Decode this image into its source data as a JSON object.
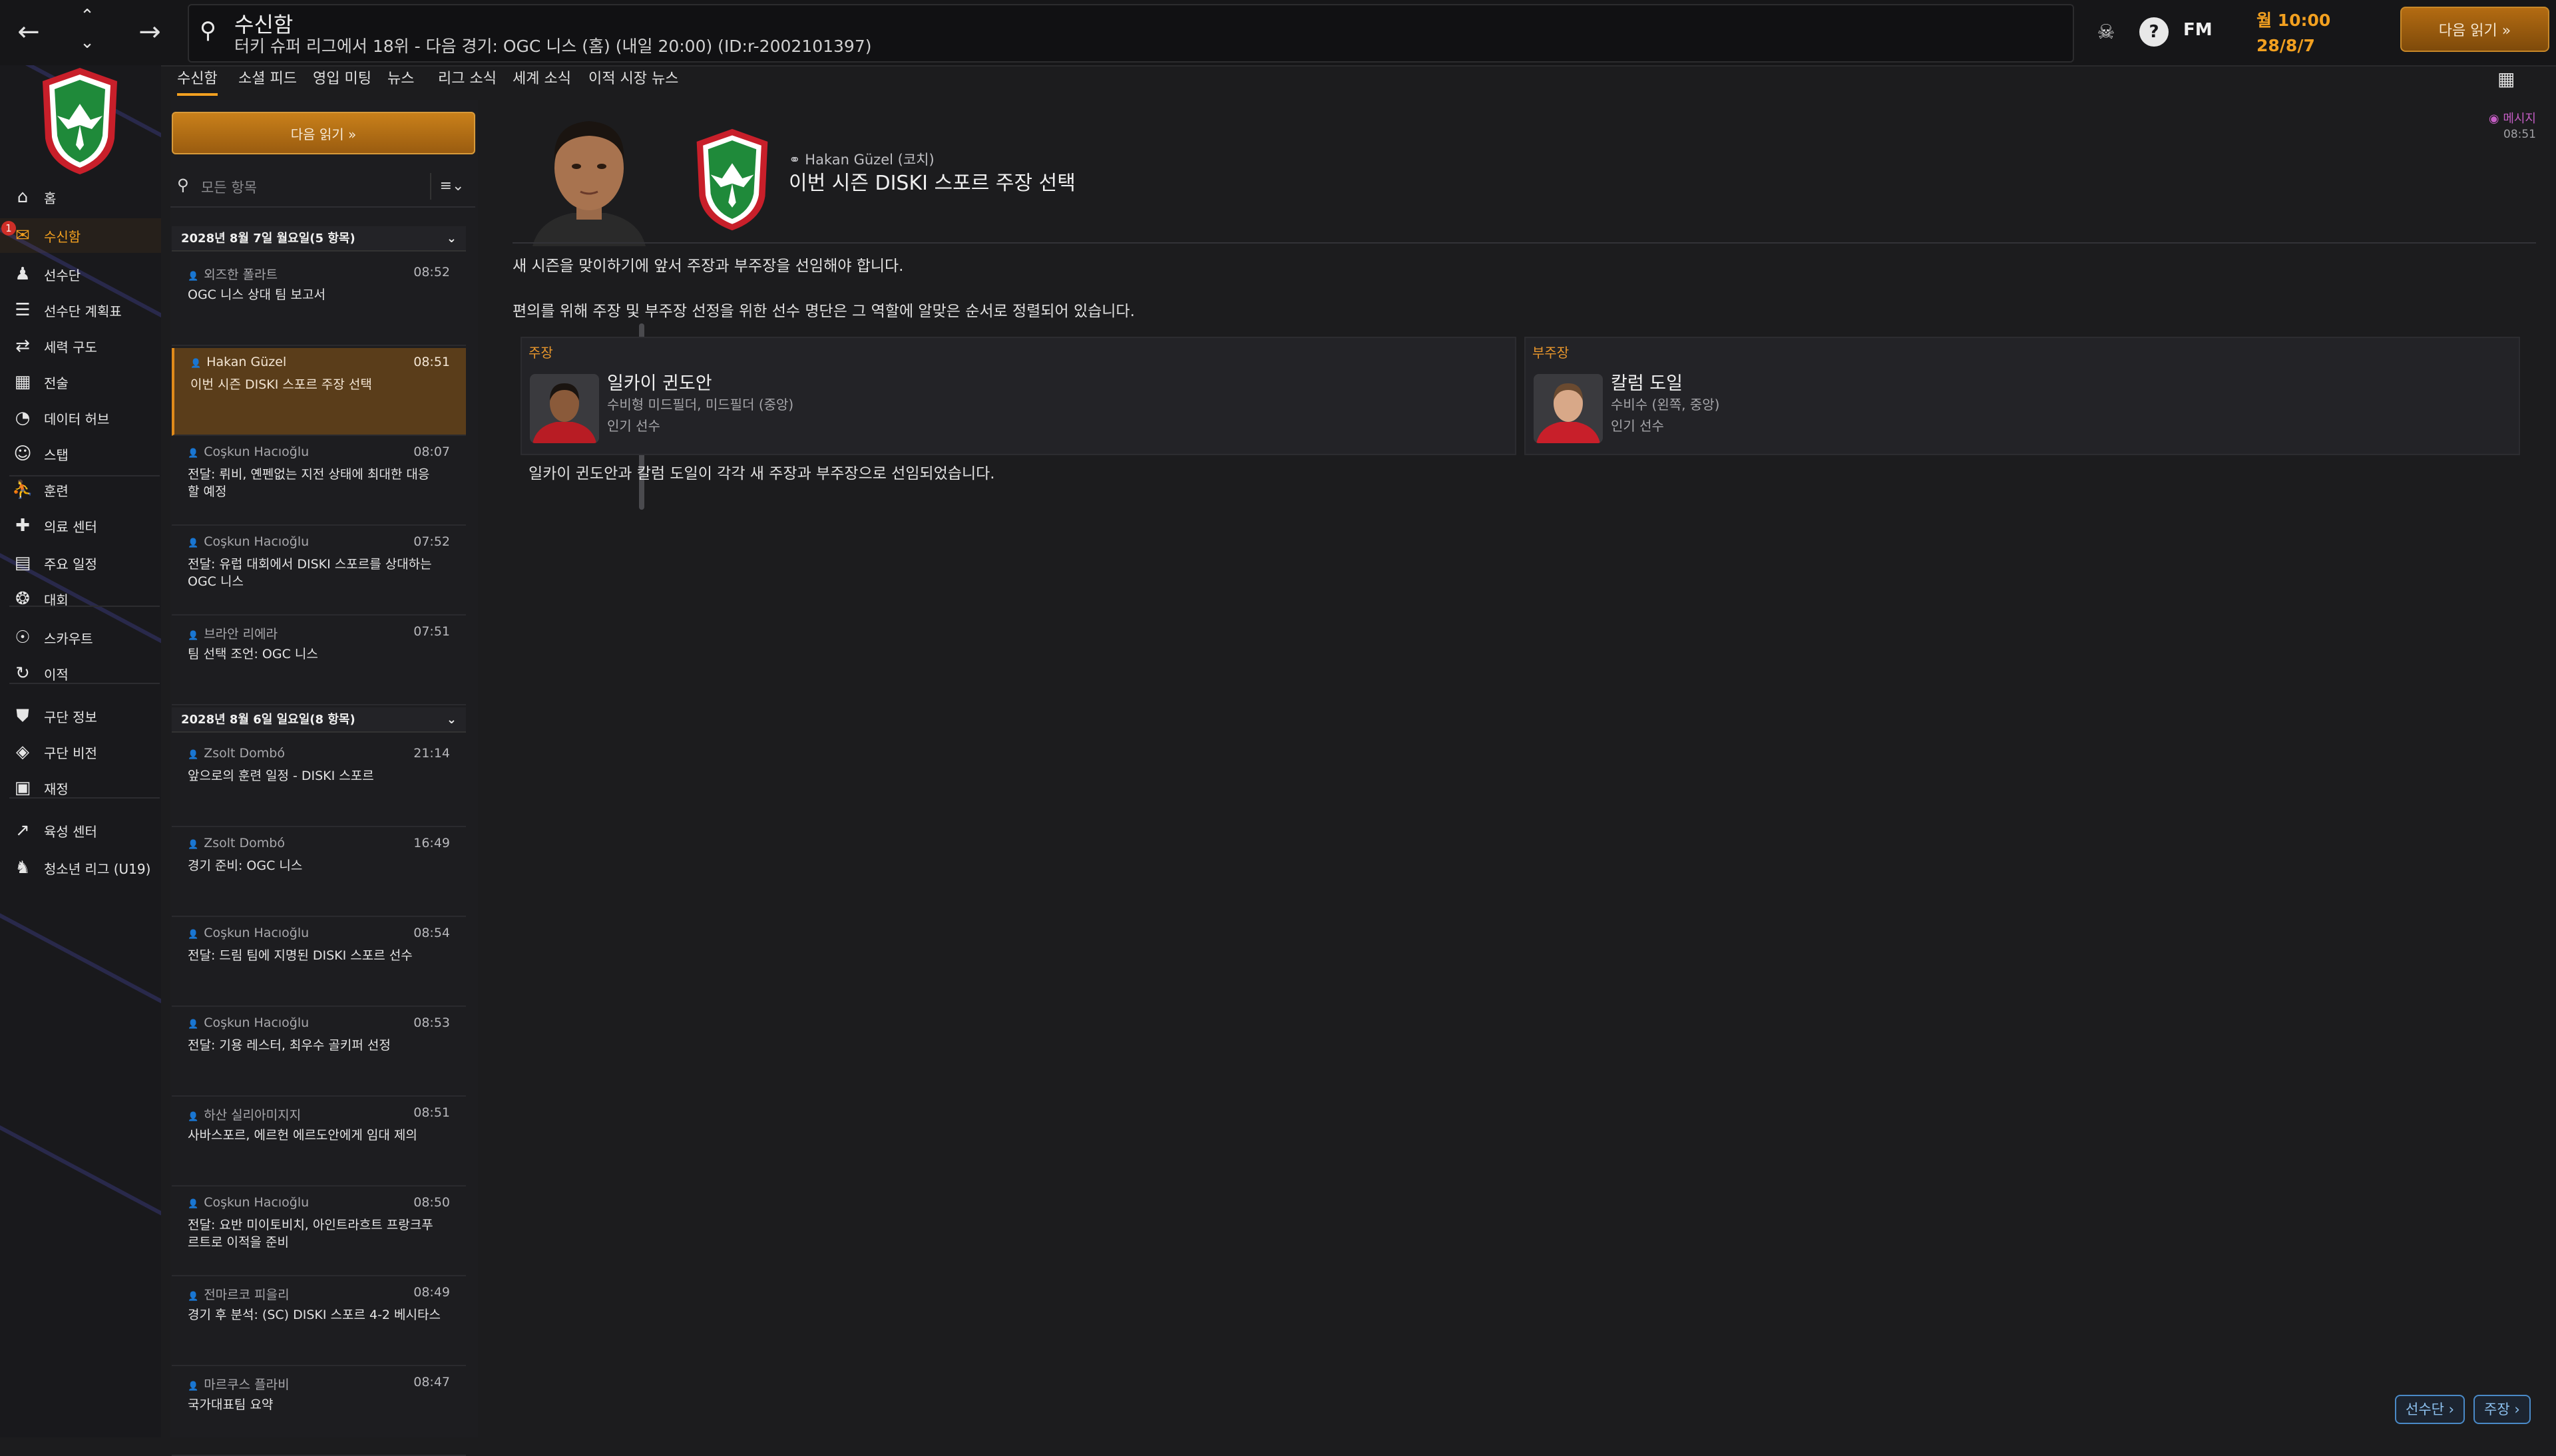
{
  "header": {
    "title": "수신함",
    "subtitle": "터키 슈퍼 리그에서 18위 - 다음 경기: OGC 니스 (홈) (내일 20:00) (ID:r-2002101397)",
    "fm_label": "FM",
    "day_time": "월 10:00",
    "date": "28/8/7",
    "continue_label": "다음 읽기 »"
  },
  "tabs": [
    "수신함",
    "소셜 피드",
    "영입 미팅",
    "뉴스",
    "리그 소식",
    "세계 소식",
    "이적 시장 뉴스"
  ],
  "sidebar": {
    "badge": "1",
    "items": [
      {
        "label": "홈",
        "icon": "home-icon"
      },
      {
        "label": "수신함",
        "icon": "inbox-icon"
      },
      {
        "label": "선수단",
        "icon": "squad-icon"
      },
      {
        "label": "선수단 계획표",
        "icon": "planner-icon"
      },
      {
        "label": "세력 구도",
        "icon": "dynamics-icon"
      },
      {
        "label": "전술",
        "icon": "tactics-icon"
      },
      {
        "label": "데이터 허브",
        "icon": "data-hub-icon"
      },
      {
        "label": "스탭",
        "icon": "staff-icon"
      },
      {
        "label": "훈련",
        "icon": "training-icon"
      },
      {
        "label": "의료 센터",
        "icon": "medical-icon"
      },
      {
        "label": "주요 일정",
        "icon": "schedule-icon"
      },
      {
        "label": "대회",
        "icon": "trophy-icon"
      },
      {
        "label": "스카우트",
        "icon": "scout-icon"
      },
      {
        "label": "이적",
        "icon": "transfer-icon"
      },
      {
        "label": "구단 정보",
        "icon": "club-info-icon"
      },
      {
        "label": "구단 비전",
        "icon": "club-vision-icon"
      },
      {
        "label": "재정",
        "icon": "finance-icon"
      },
      {
        "label": "육성 센터",
        "icon": "development-icon"
      },
      {
        "label": "청소년 리그 (U19)",
        "icon": "youth-icon"
      }
    ]
  },
  "inbox": {
    "continue_label": "다음 읽기 »",
    "filter_placeholder": "모든 항목",
    "groups": [
      {
        "date": "2028년 8월 7일 월요일(5 항목)",
        "messages": [
          {
            "from": "외즈한 폴라트",
            "time": "08:52",
            "subject": "OGC 니스 상대 팀 보고서"
          },
          {
            "from": "Hakan Güzel",
            "time": "08:51",
            "subject": "이번 시즌 DISKI 스포르 주장 선택"
          },
          {
            "from": "Coşkun Hacıoğlu",
            "time": "08:07",
            "subject": "전달: 뤼비, 옌펜없는 지전 상태에 최대한 대응할 예정"
          },
          {
            "from": "Coşkun Hacıoğlu",
            "time": "07:52",
            "subject": "전달: 유럽 대회에서 DISKI 스포르를 상대하는 OGC 니스"
          },
          {
            "from": "브라안 리에라",
            "time": "07:51",
            "subject": "팀 선택 조언: OGC 니스"
          }
        ]
      },
      {
        "date": "2028년 8월 6일 일요일(8 항목)",
        "messages": [
          {
            "from": "Zsolt Dombó",
            "time": "21:14",
            "subject": "앞으로의 훈련 일정 - DISKI 스포르"
          },
          {
            "from": "Zsolt Dombó",
            "time": "16:49",
            "subject": "경기 준비: OGC 니스"
          },
          {
            "from": "Coşkun Hacıoğlu",
            "time": "08:54",
            "subject": "전달: 드림 팀에 지명된 DISKI 스포르 선수"
          },
          {
            "from": "Coşkun Hacıoğlu",
            "time": "08:53",
            "subject": "전달: 기용 레스터, 최우수 골키퍼 선정"
          },
          {
            "from": "하산 실리아미지지",
            "time": "08:51",
            "subject": "사바스포르, 에르헌 에르도안에게 임대 제의"
          },
          {
            "from": "Coşkun Hacıoğlu",
            "time": "08:50",
            "subject": "전달: 요반 미이토비치, 아인트라흐트 프랑크푸르트로 이적을 준비"
          },
          {
            "from": "전마르코 피을리",
            "time": "08:49",
            "subject": "경기 후 분석: (SC) DISKI 스포르 4-2 베시타스"
          },
          {
            "from": "마르쿠스 플라비",
            "time": "08:47",
            "subject": "국가대표팀 요약"
          }
        ]
      }
    ]
  },
  "message": {
    "sender": "Hakan Güzel (코치)",
    "title": "이번 시즌 DISKI 스포르 주장 선택",
    "tag": "메시지",
    "time": "08:51",
    "body1": "새 시즌을 맞이하기에 앞서 주장과 부주장을 선임해야 합니다.",
    "body2": "편의를 위해 주장 및 부주장 선정을 위한 선수 명단은 그 역할에 알맞은 순서로 정렬되어 있습니다.",
    "captain": {
      "role": "주장",
      "name": "일카이 귄도안",
      "position": "수비형 미드필더, 미드필더 (중앙)",
      "tag": "인기 선수"
    },
    "vice_captain": {
      "role": "부주장",
      "name": "칼럼 도일",
      "position": "수비수 (왼쪽, 중앙)",
      "tag": "인기 선수"
    },
    "conclusion": "일카이 귄도안과 칼럼 도일이 각각 새 주장과 부주장으로 선임되었습니다."
  },
  "bottom": {
    "squad_label": "선수단 ›",
    "captain_label": "주장 ›"
  },
  "colors": {
    "accent": "#f2a020",
    "background": "#1c1c1e",
    "selected": "#5a3d1a"
  }
}
